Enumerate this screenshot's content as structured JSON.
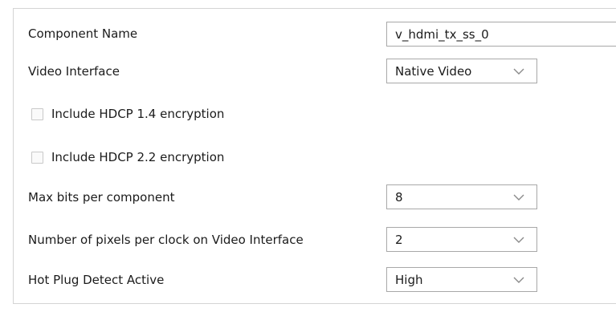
{
  "fields": {
    "component_name": {
      "label": "Component Name",
      "value": "v_hdmi_tx_ss_0"
    },
    "video_interface": {
      "label": "Video Interface",
      "value": "Native Video"
    },
    "hdcp14": {
      "label": "Include HDCP 1.4 encryption",
      "checked": false
    },
    "hdcp22": {
      "label": "Include HDCP 2.2 encryption",
      "checked": false
    },
    "max_bits": {
      "label": "Max bits per component",
      "value": "8"
    },
    "pixels_per_clock": {
      "label": "Number of pixels per clock on Video Interface",
      "value": "2"
    },
    "hot_plug": {
      "label": "Hot Plug Detect Active",
      "value": "High"
    }
  },
  "icons": {
    "dropdown": "chevron-down-icon"
  },
  "colors": {
    "border": "#a8a8a8",
    "chevron": "#8a8a8a"
  }
}
